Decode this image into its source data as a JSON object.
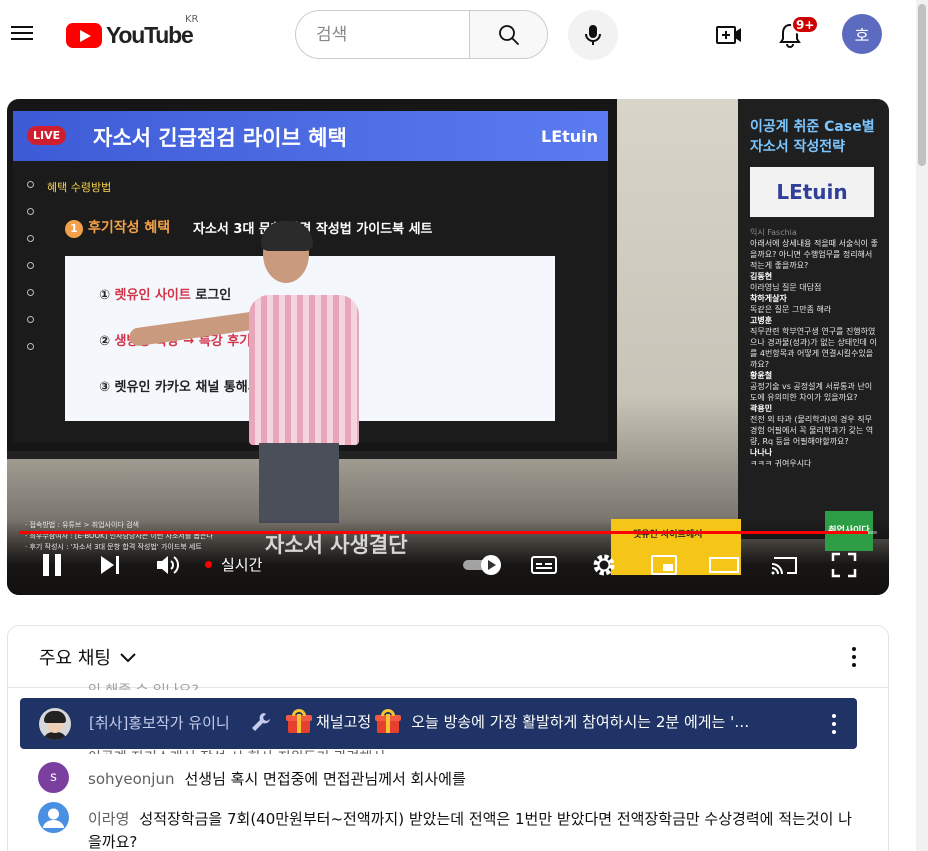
{
  "header": {
    "logo_text": "YouTube",
    "region": "KR",
    "search_placeholder": "검색",
    "notification_count": "9+",
    "avatar_letter": "호"
  },
  "player": {
    "slide": {
      "live_badge": "LIVE",
      "title": "자소서 긴급점검 라이브 혜택",
      "brand": "LEtuin",
      "benefit_tag": "혜택 수령방법",
      "section_number": "1",
      "section_title": "후기작성 혜택",
      "section_subtitle": "자소서 3대 문항 합격 작성법 가이드북 세트",
      "lines": [
        {
          "num": "①",
          "highlight": "렛유인 사이트",
          "rest": " 로그인"
        },
        {
          "num": "②",
          "highlight": "생방송 특강 → 특강 후기",
          "rest": ""
        },
        {
          "num": "③",
          "highlight": "",
          "rest": "렛유인 카카오 채널 통해서"
        }
      ]
    },
    "side_panel": {
      "title": "이공계 취준 Case별 자소서 작성전략",
      "logo": "LEtuin",
      "chat": [
        {
          "name": "익시 Faschia",
          "text": "아래서에 상세내용 적을때 서술식이 좋을까요? 아니면 수행업무를 정리해서 적는게 좋을까요?"
        },
        {
          "name": "김동현",
          "text": "이라영님 질문 대답점"
        },
        {
          "name": "착하게살자",
          "text": "독같은 질문 그만좀 해라"
        },
        {
          "name": "고병훈",
          "text": "직무관련 학부연구생 연구를 진행하였으나 경과물(성과)가 없는 상태인데 이를 4번항목과 어떻게 연결시킬수있을까요?"
        },
        {
          "name": "황윤철",
          "text": "공정기술 vs 공정설계 서류통과 난이도에 유의미한 차이가 있을까요?"
        },
        {
          "name": "곽용민",
          "text": "전전 외 타과 (물리학과)의 경우 직무경험 어필에서 꼭 물리학과가 갖는 역량, Rq 등을 어필해야할까요?"
        },
        {
          "name": "나나나",
          "text": "ㅋㅋㅋ 귀여우시다"
        }
      ]
    },
    "caption_lines": [
      "· 접속방법 : 유튜브 > 취업사이다 검색",
      "· 최우수참여자 : [E-BOOK] 인사담당자는 이런 자소서를 뽑는다",
      "· 후기 작성시 : '자소서 3대 문항 합격 작성법' 가이드북 세트"
    ],
    "banner_text": "자소서 사생결단",
    "yellow_badge": "렛유인 사이트에서",
    "green_badge": "취업사이다",
    "live_label": "실시간",
    "progress_percent": 99
  },
  "chat": {
    "title": "주요 채팅",
    "faded_text": "인 해줄 수 있나요?",
    "pinned": {
      "author": "[취사]홍보작가 유이니",
      "label": "채널고정",
      "message": "오늘 방송에 가장 활발하게 참여하시는 2분 에게는 '…"
    },
    "behind_text": "이공계 자기소개서 작성 시 회사 지원동기 관련해서",
    "messages": [
      {
        "avatar_letter": "s",
        "avatar_color": "#7b3fa0",
        "author": "sohyeonjun",
        "text": "선생님 혹시 면접중에 면접관님께서 회사에를"
      },
      {
        "avatar_letter": "",
        "avatar_color": "#4a90e2",
        "author": "이라영",
        "text": "성적장학금을 7회(40만원부터~전액까지) 받았는데 전액은 1번만 받았다면 전액장학금만 수상경력에 적는것이 나을까요?"
      }
    ]
  },
  "colors": {
    "brand_red": "#ff0000",
    "pinned_bg": "#1f3366",
    "avatar_bg": "#5c6bc0"
  }
}
